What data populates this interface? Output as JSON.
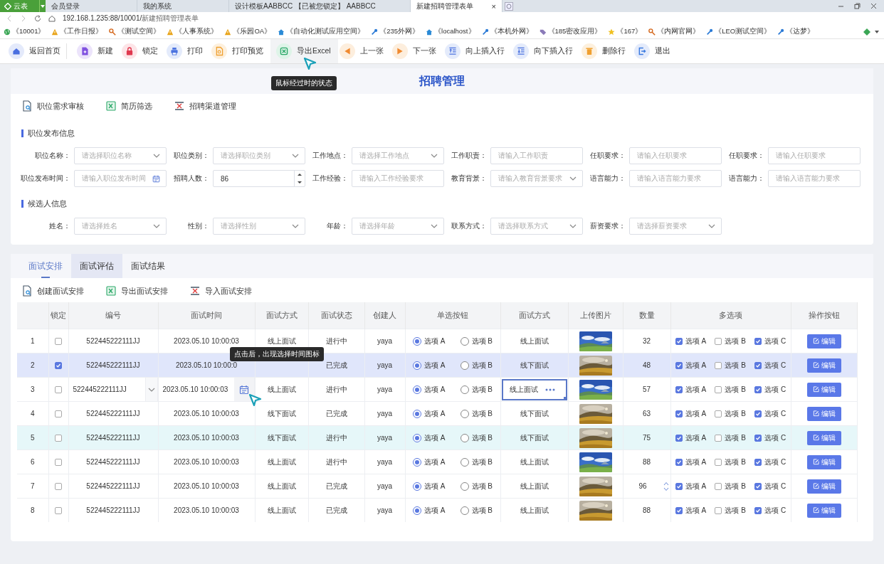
{
  "browser": {
    "brand": "云表",
    "tabs": [
      {
        "label": "会员登录",
        "selected": false
      },
      {
        "label": "我的系统",
        "selected": false
      },
      {
        "label": "设计模板AABBCC 【已被您锁定】 AABBCC",
        "selected": false
      },
      {
        "label": "新建招聘管理表单",
        "selected": true
      }
    ],
    "close": "×",
    "address_host": "192.168.1.235:88/10001/",
    "address_path": "新建招聘管理表单",
    "bookmarks": [
      "《10001》",
      "《工作日报》",
      "《测试空间》",
      "《人事系统》",
      "《乐园OA》",
      "《自动化测试应用空间》",
      "《235外网》",
      "《localhost》",
      "《本机外网》",
      "《185密改应用》",
      "《167》",
      "《内网官网》",
      "《LEO测试空间》",
      "《达梦》"
    ]
  },
  "toolbar": {
    "items": [
      {
        "label": "返回首页",
        "hovered": false
      },
      {
        "label": "新建",
        "hovered": false
      },
      {
        "label": "锁定",
        "hovered": false
      },
      {
        "label": "打印",
        "hovered": false
      },
      {
        "label": "打印预览",
        "hovered": false
      },
      {
        "label": "导出Excel",
        "hovered": true
      },
      {
        "label": "上一张",
        "hovered": false
      },
      {
        "label": "下一张",
        "hovered": false
      },
      {
        "label": "向上插入行",
        "hovered": false
      },
      {
        "label": "向下插入行",
        "hovered": false
      },
      {
        "label": "删除行",
        "hovered": false
      },
      {
        "label": "退出",
        "hovered": false
      }
    ],
    "tooltip": "鼠标经过时的状态"
  },
  "title": "招聘管理",
  "actions": [
    "职位需求审核",
    "简历筛选",
    "招聘渠道管理"
  ],
  "sections": [
    {
      "title": "职位发布信息",
      "fields": [
        {
          "label": "职位名称：",
          "kind": "select",
          "placeholder": "请选择职位名称"
        },
        {
          "label": "职位类别：",
          "kind": "select",
          "placeholder": "请选择职位类别"
        },
        {
          "label": "工作地点：",
          "kind": "select",
          "placeholder": "请选择工作地点"
        },
        {
          "label": "工作职责：",
          "kind": "text",
          "placeholder": "请输入工作职责"
        },
        {
          "label": "任职要求：",
          "kind": "text",
          "placeholder": "请输入任职要求"
        },
        {
          "label": "任职要求：",
          "kind": "text",
          "placeholder": "请输入任职要求"
        },
        {
          "label": "职位发布时间：",
          "kind": "date",
          "placeholder": "请输入职位发布时间"
        },
        {
          "label": "招聘人数：",
          "kind": "number",
          "value": "86"
        },
        {
          "label": "工作经验：",
          "kind": "text",
          "placeholder": "请输入工作经验要求"
        },
        {
          "label": "教育背景：",
          "kind": "select",
          "placeholder": "请输入教育背景要求"
        },
        {
          "label": "语言能力：",
          "kind": "text",
          "placeholder": "请输入语言能力要求"
        },
        {
          "label": "语言能力：",
          "kind": "text",
          "placeholder": "请输入语言能力要求"
        }
      ]
    },
    {
      "title": "候选人信息",
      "fields": [
        {
          "label": "姓名：",
          "kind": "select",
          "placeholder": "请选择姓名"
        },
        {
          "label": "性别：",
          "kind": "select",
          "placeholder": "请选择性别"
        },
        {
          "label": "年龄：",
          "kind": "select",
          "placeholder": "请选择年龄"
        },
        {
          "label": "联系方式：",
          "kind": "select",
          "placeholder": "请选择联系方式"
        },
        {
          "label": "薪资要求：",
          "kind": "select",
          "placeholder": "请选择薪资要求"
        }
      ]
    }
  ],
  "interview": {
    "tabs": [
      {
        "label": "面试安排",
        "selected": true,
        "hovered": false
      },
      {
        "label": "面试评估",
        "selected": false,
        "hovered": true
      },
      {
        "label": "面试结果",
        "selected": false,
        "hovered": false
      }
    ],
    "actions": [
      "创建面试安排",
      "导出面试安排",
      "导入面试安排"
    ],
    "tooltip": "点击后，出现选择时间图标",
    "table": {
      "columns": [
        "锁定",
        "编号",
        "面试时间",
        "面试方式",
        "面试状态",
        "创建人",
        "单选按钮",
        "面试方式",
        "上传图片",
        "数量",
        "多选项",
        "操作按钮"
      ],
      "rows": [
        {
          "index": "1",
          "locked": false,
          "selected": false,
          "hovered": false,
          "editing": false,
          "qty_editing": false,
          "id": "522445222111JJ",
          "time": "2023.05.10 10:00:03",
          "mode": "线上面试",
          "status": "进行中",
          "creator": "yaya",
          "radios": [
            {
              "label": "选项 A",
              "selected": true
            },
            {
              "label": "选项 B",
              "selected": false
            }
          ],
          "mode2": "线上面试",
          "qty": "32",
          "checks": [
            {
              "label": "选项 A",
              "checked": true
            },
            {
              "label": "选项 B",
              "checked": false
            },
            {
              "label": "选项 C",
              "checked": true
            }
          ],
          "button": "编辑"
        },
        {
          "index": "2",
          "locked": true,
          "selected": true,
          "hovered": false,
          "editing": false,
          "qty_editing": false,
          "id": "522445222111JJ",
          "time": "2023.05.10 10:00:0",
          "status": "已完成",
          "creator": "yaya",
          "radios": [
            {
              "label": "选项 A",
              "selected": true
            },
            {
              "label": "选项 B",
              "selected": false
            }
          ],
          "mode2": "线下面试",
          "qty": "48",
          "checks": [
            {
              "label": "选项 A",
              "checked": true
            },
            {
              "label": "选项 B",
              "checked": false
            },
            {
              "label": "选项 C",
              "checked": true
            }
          ],
          "button": "编辑"
        },
        {
          "index": "3",
          "locked": false,
          "selected": false,
          "hovered": false,
          "editing": true,
          "qty_editing": false,
          "id": "522445222111JJ",
          "time": "2023.05.10 10:00:03",
          "mode": "线上面试",
          "status": "进行中",
          "creator": "yaya",
          "radios": [
            {
              "label": "选项 A",
              "selected": true
            },
            {
              "label": "选项 B",
              "selected": false
            }
          ],
          "mode2": "线上面试",
          "qty": "57",
          "checks": [
            {
              "label": "选项 A",
              "checked": true
            },
            {
              "label": "选项 B",
              "checked": false
            },
            {
              "label": "选项 C",
              "checked": true
            }
          ],
          "button": "编辑"
        },
        {
          "index": "4",
          "locked": false,
          "selected": false,
          "hovered": false,
          "editing": false,
          "qty_editing": false,
          "id": "522445222111JJ",
          "time": "2023.05.10 10:00:03",
          "mode": "线下面试",
          "status": "已完成",
          "creator": "yaya",
          "radios": [
            {
              "label": "选项 A",
              "selected": true
            },
            {
              "label": "选项 B",
              "selected": false
            }
          ],
          "mode2": "线下面试",
          "qty": "63",
          "checks": [
            {
              "label": "选项 A",
              "checked": true
            },
            {
              "label": "选项 B",
              "checked": false
            },
            {
              "label": "选项 C",
              "checked": true
            }
          ],
          "button": "编辑"
        },
        {
          "index": "5",
          "locked": false,
          "selected": false,
          "hovered": true,
          "editing": false,
          "qty_editing": false,
          "id": "522445222111JJ",
          "time": "2023.05.10 10:00:03",
          "mode": "线下面试",
          "status": "进行中",
          "creator": "yaya",
          "radios": [
            {
              "label": "选项 A",
              "selected": true
            },
            {
              "label": "选项 B",
              "selected": false
            }
          ],
          "mode2": "线下面试",
          "qty": "75",
          "checks": [
            {
              "label": "选项 A",
              "checked": true
            },
            {
              "label": "选项 B",
              "checked": false
            },
            {
              "label": "选项 C",
              "checked": true
            }
          ],
          "button": "编辑"
        },
        {
          "index": "6",
          "locked": false,
          "selected": false,
          "hovered": false,
          "editing": false,
          "qty_editing": false,
          "id": "522445222111JJ",
          "time": "2023.05.10 10:00:03",
          "mode": "线上面试",
          "status": "进行中",
          "creator": "yaya",
          "radios": [
            {
              "label": "选项 A",
              "selected": true
            },
            {
              "label": "选项 B",
              "selected": false
            }
          ],
          "mode2": "线上面试",
          "qty": "88",
          "checks": [
            {
              "label": "选项 A",
              "checked": true
            },
            {
              "label": "选项 B",
              "checked": false
            },
            {
              "label": "选项 C",
              "checked": true
            }
          ],
          "button": "编辑"
        },
        {
          "index": "7",
          "locked": false,
          "selected": false,
          "hovered": false,
          "editing": false,
          "qty_editing": true,
          "id": "522445222111JJ",
          "time": "2023.05.10 10:00:03",
          "mode": "线上面试",
          "status": "已完成",
          "creator": "yaya",
          "radios": [
            {
              "label": "选项 A",
              "selected": true
            },
            {
              "label": "选项 B",
              "selected": false
            }
          ],
          "mode2": "线上面试",
          "qty": "96",
          "checks": [
            {
              "label": "选项 A",
              "checked": true
            },
            {
              "label": "选项 B",
              "checked": false
            },
            {
              "label": "选项 C",
              "checked": true
            }
          ],
          "button": "编辑"
        },
        {
          "index": "8",
          "locked": false,
          "selected": false,
          "hovered": false,
          "editing": false,
          "qty_editing": false,
          "id": "522445222111JJ",
          "time": "2023.05.10 10:00:03",
          "mode": "线上面试",
          "status": "已完成",
          "creator": "yaya",
          "radios": [
            {
              "label": "选项 A",
              "selected": true
            },
            {
              "label": "选项 B",
              "selected": false
            }
          ],
          "mode2": "线上面试",
          "qty": "88",
          "checks": [
            {
              "label": "选项 A",
              "checked": true
            },
            {
              "label": "选项 B",
              "checked": false
            },
            {
              "label": "选项 C",
              "checked": true
            }
          ],
          "button": "编辑"
        }
      ]
    }
  }
}
